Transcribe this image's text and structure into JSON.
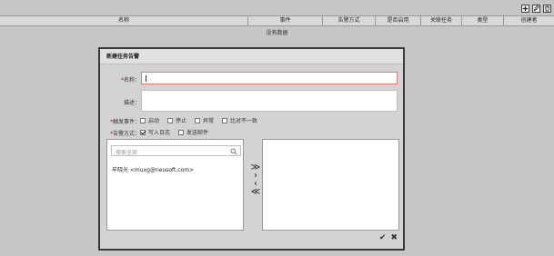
{
  "toolbar": {
    "add_icon": "plus-square-icon",
    "edit_icon": "edit-icon",
    "delete_icon": "trash-icon"
  },
  "table": {
    "columns": [
      "名称",
      "事件",
      "告警方式",
      "是否启用",
      "关联任务",
      "类型",
      "创建者"
    ],
    "empty_text": "没有数据"
  },
  "dialog": {
    "title": "新建任务告警",
    "name_label": "名称：",
    "name_value": "",
    "desc_label": "描述：",
    "desc_value": "",
    "trigger_label": "触发事件：",
    "trigger_options": [
      {
        "label": "启动",
        "checked": false
      },
      {
        "label": "停止",
        "checked": false
      },
      {
        "label": "异常",
        "checked": false
      },
      {
        "label": "比对不一致",
        "checked": false
      }
    ],
    "method_label": "告警方式：",
    "method_options": [
      {
        "label": "写入日志",
        "checked": true
      },
      {
        "label": "发送邮件",
        "checked": false
      }
    ],
    "search_placeholder": "搜索全部",
    "available_users": [
      "牟晓光 <muxg@neusoft.com>"
    ],
    "selected_users": [],
    "move_all_right": "≫",
    "move_right": "›",
    "move_left": "‹",
    "move_all_left": "≪",
    "confirm_symbol": "✔",
    "cancel_symbol": "✖"
  }
}
